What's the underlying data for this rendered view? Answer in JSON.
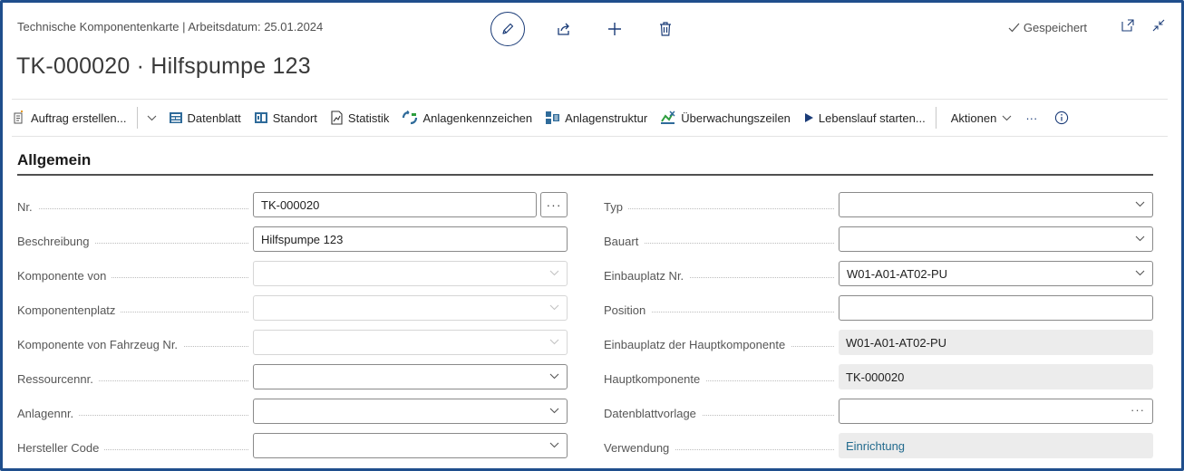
{
  "header": {
    "breadcrumb": "Technische Komponentenkarte | Arbeitsdatum: 25.01.2024",
    "title": "TK-000020 · Hilfspumpe 123",
    "status": "Gespeichert"
  },
  "actionbar": {
    "items": [
      {
        "label": "Auftrag erstellen...",
        "icon": "new-order-icon"
      },
      {
        "label": "Datenblatt",
        "icon": "datasheet-icon"
      },
      {
        "label": "Standort",
        "icon": "location-icon"
      },
      {
        "label": "Statistik",
        "icon": "statistics-icon"
      },
      {
        "label": "Anlagenkennzeichen",
        "icon": "tag-icon"
      },
      {
        "label": "Anlagenstruktur",
        "icon": "structure-icon"
      },
      {
        "label": "Überwachungszeilen",
        "icon": "monitoring-icon"
      },
      {
        "label": "Lebenslauf starten...",
        "icon": "play-icon"
      }
    ],
    "actions_label": "Aktionen",
    "more": "···"
  },
  "section": {
    "title": "Allgemein"
  },
  "left_fields": [
    {
      "label": "Nr.",
      "value": "TK-000020"
    },
    {
      "label": "Beschreibung",
      "value": "Hilfspumpe 123"
    },
    {
      "label": "Komponente von",
      "value": ""
    },
    {
      "label": "Komponentenplatz",
      "value": ""
    },
    {
      "label": "Komponente von Fahrzeug Nr.",
      "value": ""
    },
    {
      "label": "Ressourcennr.",
      "value": ""
    },
    {
      "label": "Anlagennr.",
      "value": ""
    },
    {
      "label": "Hersteller Code",
      "value": ""
    }
  ],
  "right_fields": [
    {
      "label": "Typ",
      "value": ""
    },
    {
      "label": "Bauart",
      "value": ""
    },
    {
      "label": "Einbauplatz Nr.",
      "value": "W01-A01-AT02-PU"
    },
    {
      "label": "Position",
      "value": ""
    },
    {
      "label": "Einbauplatz der Hauptkomponente",
      "value": "W01-A01-AT02-PU"
    },
    {
      "label": "Hauptkomponente",
      "value": "TK-000020"
    },
    {
      "label": "Datenblattvorlage",
      "value": ""
    },
    {
      "label": "Verwendung",
      "value": "Einrichtung"
    }
  ],
  "lookup_button": "···"
}
